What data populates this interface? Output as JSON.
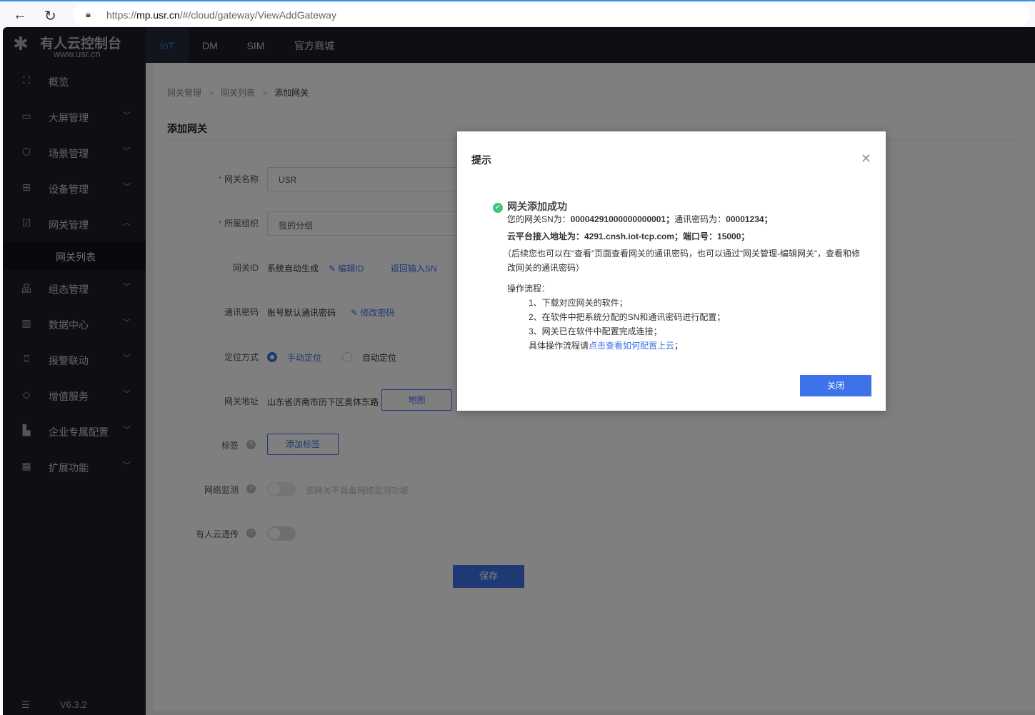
{
  "browser": {
    "back": "←",
    "reload": "↻",
    "url_prefix": "https://",
    "url_host": "mp.usr.cn",
    "url_path": "/#/cloud/gateway/ViewAddGateway"
  },
  "logo": {
    "title": "有人云控制台",
    "subtitle": "www.usr.cn"
  },
  "topnav": {
    "tabs": [
      {
        "label": "IoT"
      },
      {
        "label": "DM"
      },
      {
        "label": "SIM"
      },
      {
        "label": "官方商城"
      }
    ]
  },
  "sidebar": {
    "items": [
      {
        "label": "概览",
        "icon": "scan-icon"
      },
      {
        "label": "大屏管理",
        "icon": "monitor-icon"
      },
      {
        "label": "场景管理",
        "icon": "cube-icon"
      },
      {
        "label": "设备管理",
        "icon": "device-icon"
      },
      {
        "label": "网关管理",
        "icon": "gateway-icon",
        "expanded": true,
        "children": [
          {
            "label": "网关列表"
          }
        ]
      },
      {
        "label": "组态管理",
        "icon": "topology-icon"
      },
      {
        "label": "数据中心",
        "icon": "bar-chart-icon"
      },
      {
        "label": "报警联动",
        "icon": "alarm-icon"
      },
      {
        "label": "增值服务",
        "icon": "diamond-icon"
      },
      {
        "label": "企业专属配置",
        "icon": "building-icon"
      },
      {
        "label": "扩展功能",
        "icon": "grid-icon"
      }
    ],
    "version": "V6.3.2"
  },
  "breadcrumb": [
    "网关管理",
    "网关列表",
    "添加网关"
  ],
  "page_title": "添加网关",
  "form": {
    "name": {
      "label": "网关名称",
      "value": "USR"
    },
    "org": {
      "label": "所属组织",
      "value": "我的分组"
    },
    "id": {
      "label": "网关ID",
      "value": "系统自动生成",
      "edit": "编辑ID",
      "back": "返回输入SN"
    },
    "password": {
      "label": "通讯密码",
      "value": "账号默认通讯密码",
      "edit": "修改密码"
    },
    "location": {
      "label": "定位方式",
      "options": [
        "手动定位",
        "自动定位"
      ],
      "selected": "手动定位"
    },
    "address": {
      "label": "网关地址",
      "value": "山东省济南市历下区奥体东路",
      "map": "地图"
    },
    "tags": {
      "label": "标签",
      "button": "添加标签"
    },
    "network": {
      "label": "网络监测",
      "hint": "该网关不具备网络监测功能",
      "on": false
    },
    "transparent": {
      "label": "有人云透传",
      "on": false
    },
    "save": "保存"
  },
  "modal": {
    "title": "提示",
    "success": "网关添加成功",
    "line1": "您的网关SN为：",
    "sn": "00004291000000000001；",
    "line1b": "通讯密码为：",
    "pwd": "00001234；",
    "line2": "云平台接入地址为：4291.cnsh.iot-tcp.com；端口号：15000；",
    "line3": "（后续您也可以在“查看”页面查看网关的通讯密码，也可以通过“网关管理-编辑网关”，查看和修",
    "line4": "改网关的通讯密码）",
    "steps_title": "操作流程：",
    "steps": [
      "1、下载对应网关的软件；",
      "2、在软件中把系统分配的SN和通讯密码进行配置；",
      "3、网关已在软件中配置完成连接；"
    ],
    "more_prefix": "具体操作流程请",
    "more_link": "点击查看如何配置上云",
    "more_suffix": "；",
    "close": "关闭"
  },
  "colors": {
    "primary": "#3e72e8",
    "success": "#3ec47c",
    "sidebar": "#1c1f2b"
  }
}
